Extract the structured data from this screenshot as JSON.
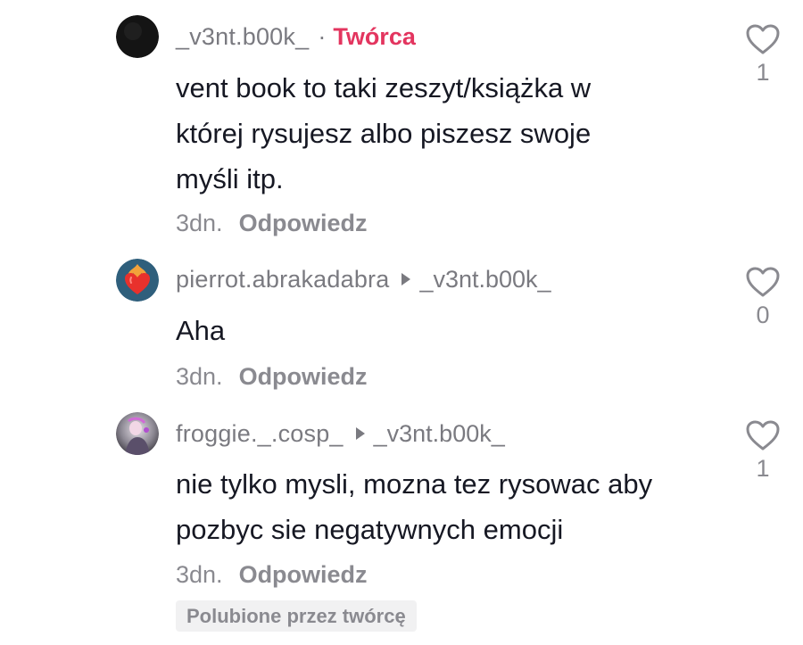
{
  "comments": [
    {
      "username": "_v3nt.b00k_",
      "separator": "·",
      "badge": "Twórca",
      "reply_to": "",
      "lines": [
        "vent book to taki zeszyt/książka w",
        "której rysujesz albo piszesz swoje",
        "myśli itp."
      ],
      "time": "3dn.",
      "reply_label": "Odpowiedz",
      "like_count": "1",
      "avatar_icon": "dark-avatar",
      "liked_by_creator": ""
    },
    {
      "username": "pierrot.abrakadabra",
      "reply_to": "_v3nt.b00k_",
      "lines": [
        "Aha"
      ],
      "time": "3dn.",
      "reply_label": "Odpowiedz",
      "like_count": "0",
      "avatar_icon": "flaming-heart-avatar"
    },
    {
      "username": "froggie._.cosp_",
      "reply_to": "_v3nt.b00k_",
      "lines": [
        "nie tylko mysli, mozna tez rysowac aby",
        "pozbyc sie negatywnych emocji"
      ],
      "time": "3dn.",
      "reply_label": "Odpowiedz",
      "like_count": "1",
      "avatar_icon": "photo-avatar",
      "liked_by_creator": "Polubione przez twórcę"
    }
  ],
  "colors": {
    "creator_badge": "#e3355f",
    "secondary_text": "#8a8a90",
    "primary_text": "#161823"
  }
}
